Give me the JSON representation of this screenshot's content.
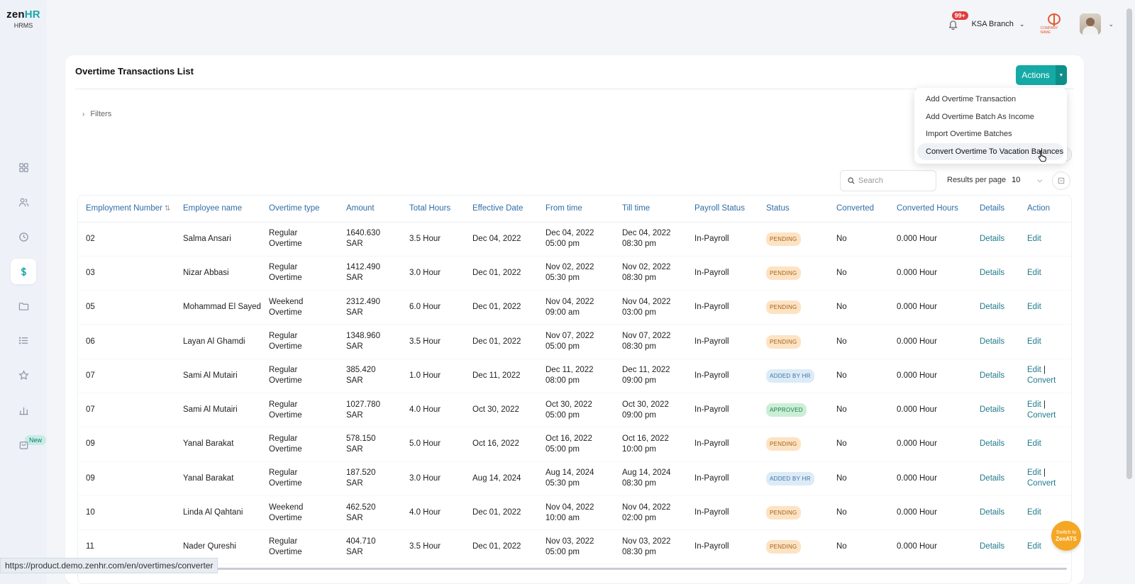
{
  "brand": {
    "name_part1": "zen",
    "name_part2": "HR",
    "product": "HRMS"
  },
  "sidebar": {
    "items": [
      {
        "icon": "dashboard-icon"
      },
      {
        "icon": "people-icon"
      },
      {
        "icon": "clock-icon"
      },
      {
        "icon": "dollar-icon",
        "active": true
      },
      {
        "icon": "folder-icon"
      },
      {
        "icon": "list-icon"
      },
      {
        "icon": "star-icon"
      },
      {
        "icon": "bar-chart-icon"
      },
      {
        "icon": "bag-icon"
      }
    ],
    "new_badge": "New"
  },
  "topbar": {
    "notifications": "99+",
    "branch": "KSA Branch",
    "company_logo_text": "COMPANY NAME"
  },
  "page": {
    "title": "Overtime Transactions List",
    "actions_label": "Actions",
    "filters_label": "Filters",
    "search_placeholder": "Search",
    "results_per_page_label": "Results per page",
    "results_per_page_value": "10"
  },
  "actions_menu": [
    "Add Overtime Transaction",
    "Add Overtime Batch As Income",
    "Import Overtime Batches",
    "Convert Overtime To Vacation Balances"
  ],
  "table": {
    "headers": [
      "Employment Number",
      "Employee name",
      "Overtime type",
      "Amount",
      "Total Hours",
      "Effective Date",
      "From time",
      "Till time",
      "Payroll Status",
      "Status",
      "Converted",
      "Converted Hours",
      "Details",
      "Action"
    ],
    "rows": [
      {
        "emp": "02",
        "name": "Salma Ansari",
        "type1": "Regular",
        "type2": "Overtime",
        "amt1": "1640.630",
        "amt2": "SAR",
        "hours": "3.5 Hour",
        "eff": "Dec 04, 2022",
        "from1": "Dec 04, 2022",
        "from2": "05:00 pm",
        "till1": "Dec 04, 2022",
        "till2": "08:30 pm",
        "payroll": "In-Payroll",
        "status": "PENDING",
        "status_kind": "pending",
        "converted": "No",
        "conv_hours": "0.000 Hour",
        "details": "Details",
        "action1": "Edit",
        "action2": ""
      },
      {
        "emp": "03",
        "name": "Nizar Abbasi",
        "type1": "Regular",
        "type2": "Overtime",
        "amt1": "1412.490",
        "amt2": "SAR",
        "hours": "3.0 Hour",
        "eff": "Dec 01, 2022",
        "from1": "Nov 02, 2022",
        "from2": "05:30 pm",
        "till1": "Nov 02, 2022",
        "till2": "08:30 pm",
        "payroll": "In-Payroll",
        "status": "PENDING",
        "status_kind": "pending",
        "converted": "No",
        "conv_hours": "0.000 Hour",
        "details": "Details",
        "action1": "Edit",
        "action2": ""
      },
      {
        "emp": "05",
        "name": "Mohammad El Sayed",
        "type1": "Weekend",
        "type2": "Overtime",
        "amt1": "2312.490",
        "amt2": "SAR",
        "hours": "6.0 Hour",
        "eff": "Dec 01, 2022",
        "from1": "Nov 04, 2022",
        "from2": "09:00 am",
        "till1": "Nov 04, 2022",
        "till2": "03:00 pm",
        "payroll": "In-Payroll",
        "status": "PENDING",
        "status_kind": "pending",
        "converted": "No",
        "conv_hours": "0.000 Hour",
        "details": "Details",
        "action1": "Edit",
        "action2": ""
      },
      {
        "emp": "06",
        "name": "Layan Al Ghamdi",
        "type1": "Regular",
        "type2": "Overtime",
        "amt1": "1348.960",
        "amt2": "SAR",
        "hours": "3.5 Hour",
        "eff": "Dec 01, 2022",
        "from1": "Nov 07, 2022",
        "from2": "05:00 pm",
        "till1": "Nov 07, 2022",
        "till2": "08:30 pm",
        "payroll": "In-Payroll",
        "status": "PENDING",
        "status_kind": "pending",
        "converted": "No",
        "conv_hours": "0.000 Hour",
        "details": "Details",
        "action1": "Edit",
        "action2": ""
      },
      {
        "emp": "07",
        "name": "Sami Al Mutairi",
        "type1": "Regular",
        "type2": "Overtime",
        "amt1": "385.420",
        "amt2": "SAR",
        "hours": "1.0 Hour",
        "eff": "Dec 11, 2022",
        "from1": "Dec 11, 2022",
        "from2": "08:00 pm",
        "till1": "Dec 11, 2022",
        "till2": "09:00 pm",
        "payroll": "In-Payroll",
        "status": "ADDED BY HR",
        "status_kind": "added",
        "converted": "No",
        "conv_hours": "0.000 Hour",
        "details": "Details",
        "action1": "Edit",
        "action2": "Convert"
      },
      {
        "emp": "07",
        "name": "Sami Al Mutairi",
        "type1": "Regular",
        "type2": "Overtime",
        "amt1": "1027.780",
        "amt2": "SAR",
        "hours": "4.0 Hour",
        "eff": "Oct 30, 2022",
        "from1": "Oct 30, 2022",
        "from2": "05:00 pm",
        "till1": "Oct 30, 2022",
        "till2": "09:00 pm",
        "payroll": "In-Payroll",
        "status": "APPROVED",
        "status_kind": "approved",
        "converted": "No",
        "conv_hours": "0.000 Hour",
        "details": "Details",
        "action1": "Edit",
        "action2": "Convert"
      },
      {
        "emp": "09",
        "name": "Yanal Barakat",
        "type1": "Regular",
        "type2": "Overtime",
        "amt1": "578.150",
        "amt2": "SAR",
        "hours": "5.0 Hour",
        "eff": "Oct 16, 2022",
        "from1": "Oct 16, 2022",
        "from2": "05:00 pm",
        "till1": "Oct 16, 2022",
        "till2": "10:00 pm",
        "payroll": "In-Payroll",
        "status": "PENDING",
        "status_kind": "pending",
        "converted": "No",
        "conv_hours": "0.000 Hour",
        "details": "Details",
        "action1": "Edit",
        "action2": ""
      },
      {
        "emp": "09",
        "name": "Yanal Barakat",
        "type1": "Regular",
        "type2": "Overtime",
        "amt1": "187.520",
        "amt2": "SAR",
        "hours": "3.0 Hour",
        "eff": "Aug 14, 2024",
        "from1": "Aug 14, 2024",
        "from2": "05:30 pm",
        "till1": "Aug 14, 2024",
        "till2": "08:30 pm",
        "payroll": "In-Payroll",
        "status": "ADDED BY HR",
        "status_kind": "added",
        "converted": "No",
        "conv_hours": "0.000 Hour",
        "details": "Details",
        "action1": "Edit",
        "action2": "Convert"
      },
      {
        "emp": "10",
        "name": "Linda Al Qahtani",
        "type1": "Weekend",
        "type2": "Overtime",
        "amt1": "462.520",
        "amt2": "SAR",
        "hours": "4.0 Hour",
        "eff": "Dec 01, 2022",
        "from1": "Nov 04, 2022",
        "from2": "10:00 am",
        "till1": "Nov 04, 2022",
        "till2": "02:00 pm",
        "payroll": "In-Payroll",
        "status": "PENDING",
        "status_kind": "pending",
        "converted": "No",
        "conv_hours": "0.000 Hour",
        "details": "Details",
        "action1": "Edit",
        "action2": ""
      },
      {
        "emp": "11",
        "name": "Nader Qureshi",
        "type1": "Regular",
        "type2": "Overtime",
        "amt1": "404.710",
        "amt2": "SAR",
        "hours": "3.5 Hour",
        "eff": "Dec 01, 2022",
        "from1": "Nov 03, 2022",
        "from2": "05:00 pm",
        "till1": "Nov 03, 2022",
        "till2": "08:30 pm",
        "payroll": "In-Payroll",
        "status": "PENDING",
        "status_kind": "pending",
        "converted": "No",
        "conv_hours": "0.000 Hour",
        "details": "Details",
        "action1": "Edit",
        "action2": ""
      }
    ]
  },
  "footer": {
    "status_url": "https://product.demo.zenhr.com/en/overtimes/converter",
    "switch_line1": "Switch to",
    "switch_line2": "ZenATS"
  },
  "colors": {
    "accent": "#15aaa5",
    "header_link": "#2f6da6",
    "link": "#1f7a8c"
  }
}
